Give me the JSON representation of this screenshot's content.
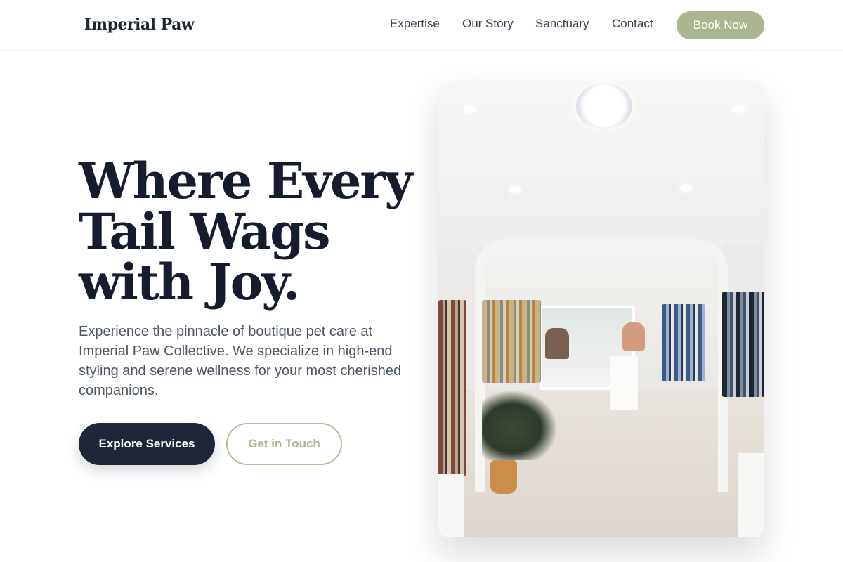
{
  "header": {
    "brand": "Imperial Paw",
    "nav": [
      {
        "label": "Expertise"
      },
      {
        "label": "Our Story"
      },
      {
        "label": "Sanctuary"
      },
      {
        "label": "Contact"
      }
    ],
    "cta_label": "Book Now"
  },
  "hero": {
    "title_lines": [
      "Where Every",
      "Tail Wags",
      "with Joy."
    ],
    "description": "Experience the pinnacle of boutique pet care at Imperial Paw Collective. We specialize in high-end styling and serene wellness for your most cherished companions.",
    "primary_button": "Explore Services",
    "secondary_button": "Get in Touch"
  },
  "colors": {
    "accent_sage": "#a8b58f",
    "navy": "#1e2638",
    "title_text": "#141c2e"
  }
}
